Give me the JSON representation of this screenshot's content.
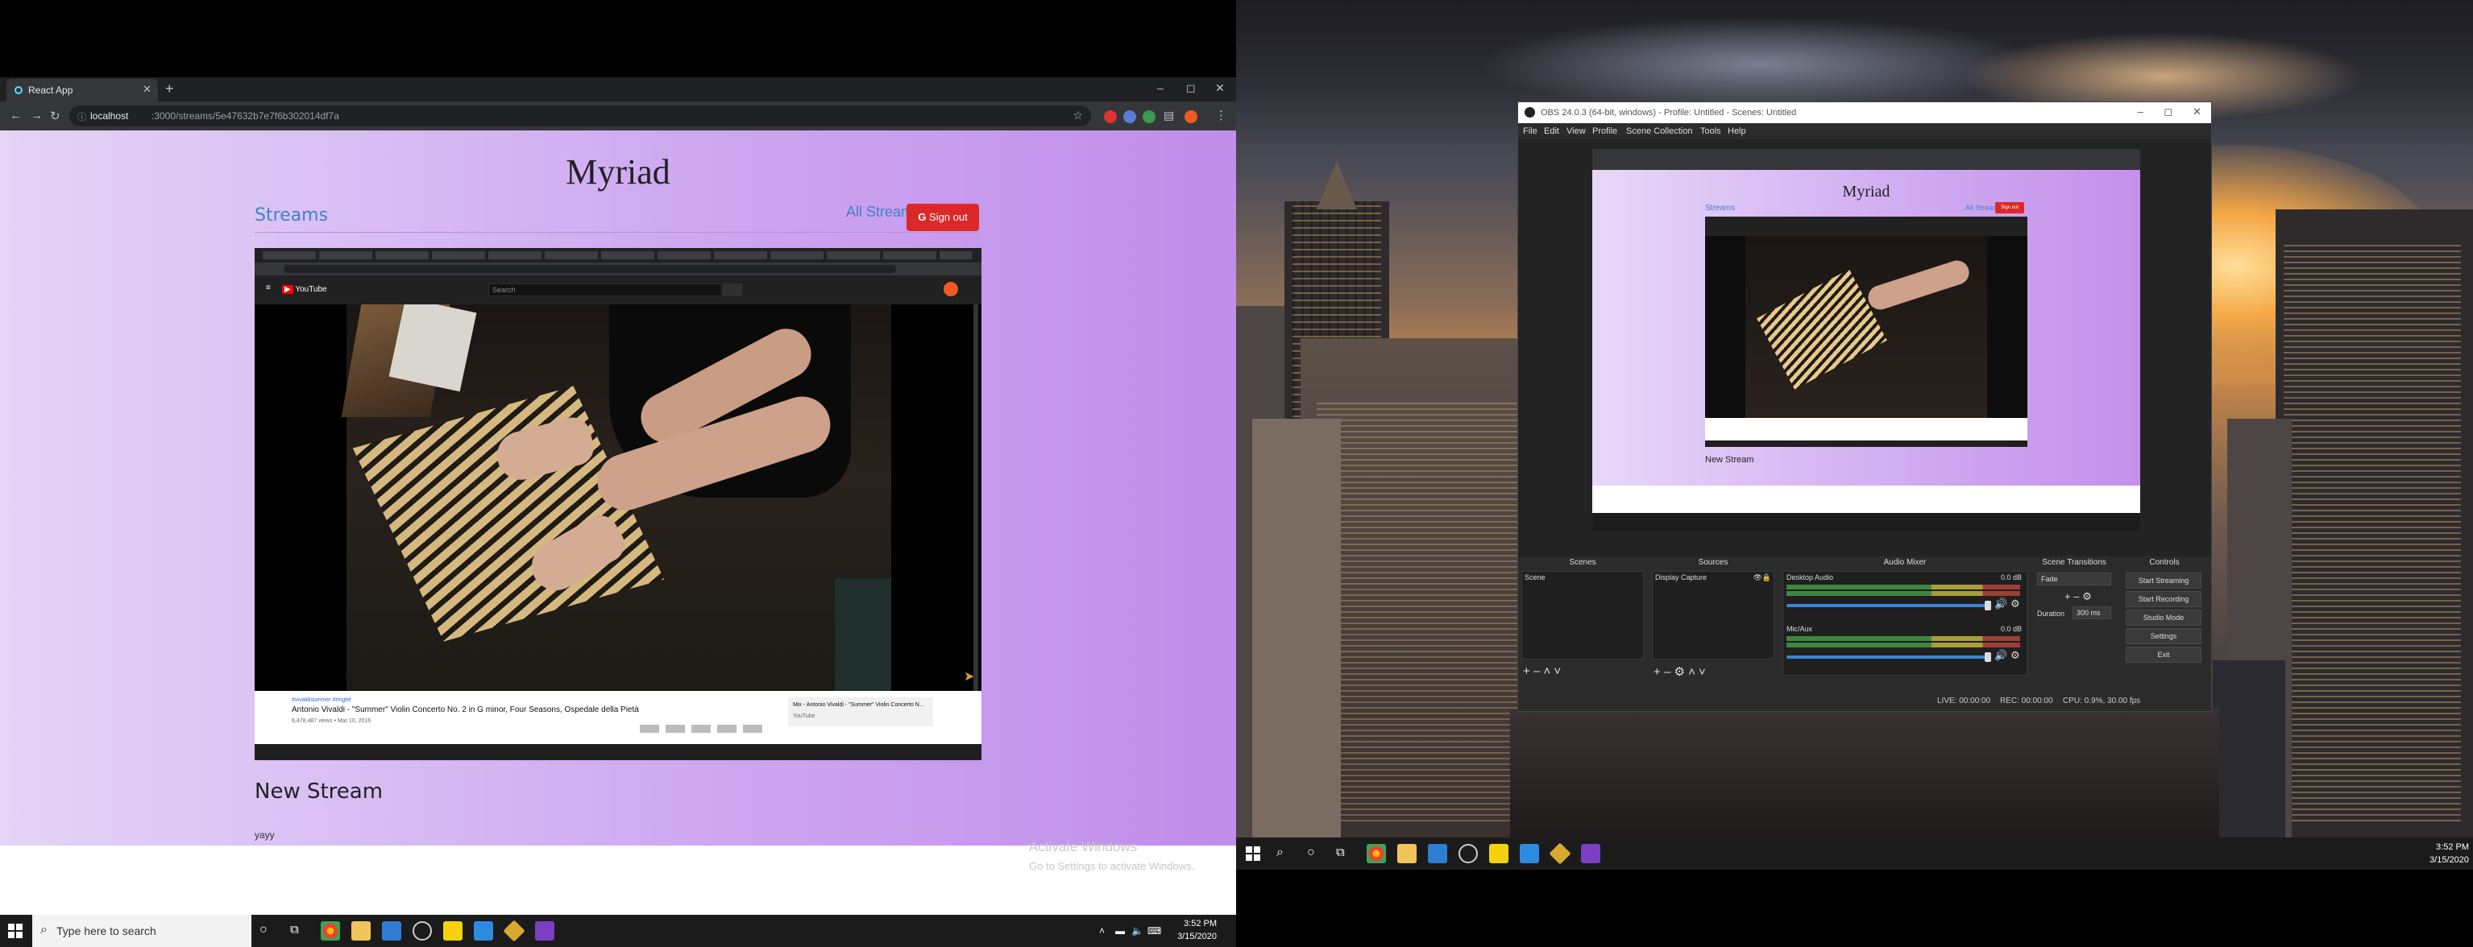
{
  "browser": {
    "tab_title": "React App",
    "url_host": "localhost",
    "url_path": ":3000/streams/5e47632b7e7f6b302014df7a",
    "new_tab": "+",
    "minimize": "–",
    "maximize": "◻",
    "close": "✕",
    "tab_close": "✕"
  },
  "site": {
    "title": "Myriad",
    "streams_link": "Streams",
    "all_streams_link": "All Streams",
    "sign_out": "Sign out",
    "new_stream_heading": "New Stream",
    "stream_description": "yayy"
  },
  "video": {
    "caption_tags": "#vivaldisummer #ringtel",
    "caption_title": "Antonio Vivaldi - \"Summer\" Violin Concerto No. 2 in G minor, Four Seasons, Ospedale della Pietà",
    "caption_meta": "6,478,487 views • Mar 10, 2016",
    "side_title": "Mix - Antonio Vivaldi - \"Summer\" Violin Concerto N...",
    "side_meta": "YouTube",
    "search_placeholder": "Search",
    "logo_text": "YouTube"
  },
  "activate": {
    "line1": "Activate Windows",
    "line2": "Go to Settings to activate Windows."
  },
  "taskbar_left": {
    "search_placeholder": "Type here to search",
    "time": "3:52 PM",
    "date": "3/15/2020"
  },
  "obs": {
    "title": "OBS 24.0.3 (64-bit, windows) - Profile: Untitled - Scenes: Untitled",
    "menus": [
      "File",
      "Edit",
      "View",
      "Profile",
      "Scene Collection",
      "Tools",
      "Help"
    ],
    "canvas": {
      "title": "Myriad",
      "streams": "Streams",
      "all_streams": "All Streams",
      "sign_out": "Sign out",
      "new_stream": "New Stream"
    },
    "docks": {
      "scenes": "Scenes",
      "sources": "Sources",
      "mixer": "Audio Mixer",
      "transitions": "Scene Transitions",
      "controls": "Controls"
    },
    "scene_item": "Scene",
    "source_item": "Display Capture",
    "mixer": {
      "desktop_label": "Desktop Audio",
      "desktop_db": "0.0 dB",
      "mic_label": "Mic/Aux",
      "mic_db": "0.0 dB"
    },
    "transitions": {
      "type": "Fade",
      "duration_label": "Duration",
      "duration_value": "300 ms"
    },
    "controls": {
      "start_streaming": "Start Streaming",
      "start_recording": "Start Recording",
      "studio_mode": "Studio Mode",
      "settings": "Settings",
      "exit": "Exit"
    },
    "status": {
      "live": "LIVE: 00:00:00",
      "rec": "REC: 00:00:00",
      "cpu": "CPU: 0.9%, 30.00 fps"
    }
  },
  "taskbar_right": {
    "time": "3:52 PM",
    "date": "3/15/2020"
  },
  "colors": {
    "accent_link": "#4183c4",
    "signout_red": "#db2828",
    "page_gradient_start": "#e4d4f6",
    "page_gradient_end": "#c08de9"
  }
}
